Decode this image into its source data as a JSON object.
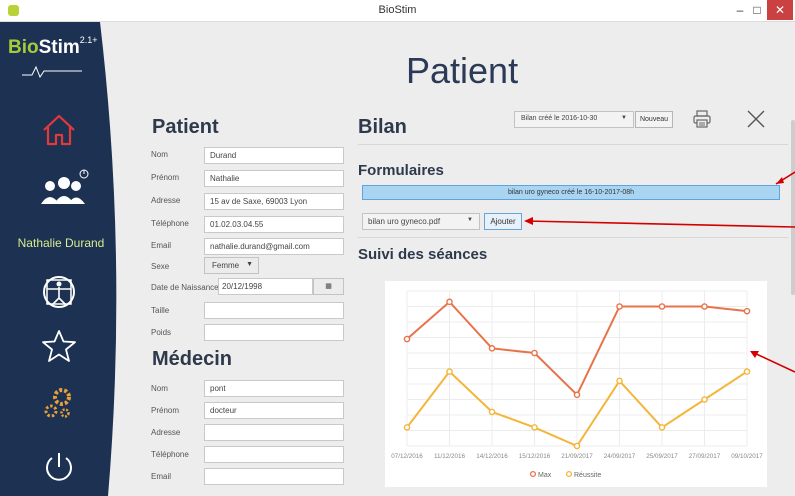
{
  "window": {
    "title": "BioStim",
    "minimize": "–",
    "maximize": "□",
    "close": "✕"
  },
  "sidebar": {
    "brand_bio": "Bio",
    "brand_stim": "Stim",
    "brand_version": "2.1+",
    "user_name": "Nathalie Durand",
    "items": [
      {
        "icon": "home-icon"
      },
      {
        "icon": "users-icon"
      },
      {
        "icon": "vitruvian-icon"
      },
      {
        "icon": "star-icon"
      },
      {
        "icon": "gears-icon"
      },
      {
        "icon": "power-icon"
      }
    ]
  },
  "page": {
    "title": "Patient"
  },
  "patient": {
    "heading": "Patient",
    "fields": [
      {
        "label": "Nom",
        "value": "Durand"
      },
      {
        "label": "Prénom",
        "value": "Nathalie"
      },
      {
        "label": "Adresse",
        "value": "15 av de Saxe, 69003 Lyon"
      },
      {
        "label": "Téléphone",
        "value": "01.02.03.04.55"
      },
      {
        "label": "Email",
        "value": "nathalie.durand@gmail.com"
      }
    ],
    "sexe_label": "Sexe",
    "sexe_value": "Femme",
    "dob_label": "Date de Naissance",
    "dob_value": "20/12/1998",
    "taille_label": "Taille",
    "taille_value": "",
    "poids_label": "Poids",
    "poids_value": ""
  },
  "medecin": {
    "heading": "Médecin",
    "fields": [
      {
        "label": "Nom",
        "value": "pont"
      },
      {
        "label": "Prénom",
        "value": "docteur"
      },
      {
        "label": "Adresse",
        "value": ""
      },
      {
        "label": "Téléphone",
        "value": ""
      },
      {
        "label": "Email",
        "value": ""
      }
    ]
  },
  "bilan": {
    "heading": "Bilan",
    "select_value": "Bilan créé le 2016-10-30",
    "nouveau_label": "Nouveau",
    "formulaires_heading": "Formulaires",
    "form_item": "bilan uro gyneco créé le 16-10-2017-08h",
    "pdf_select_value": "bilan uro gyneco.pdf",
    "ajouter_label": "Ajouter",
    "suivi_heading": "Suivi des séances"
  },
  "chart_data": {
    "type": "line",
    "x": [
      "07/12/2016",
      "11/12/2016",
      "14/12/2016",
      "15/12/2016",
      "21/09/2017",
      "24/09/2017",
      "25/09/2017",
      "27/09/2017",
      "09/10/2017"
    ],
    "series": [
      {
        "name": "Max",
        "values": [
          69,
          93,
          63,
          60,
          33,
          90,
          90,
          90,
          87
        ],
        "color": "#e8734a"
      },
      {
        "name": "Réussite",
        "values": [
          12,
          48,
          22,
          12,
          0,
          42,
          12,
          30,
          48
        ],
        "color": "#f5b53a"
      }
    ],
    "ylim": [
      0,
      100
    ],
    "grid": true,
    "legend": "bottom"
  },
  "colors": {
    "sidebar": "#1d3152",
    "accent_green": "#a4cc3a",
    "home_red": "#e03a3a"
  }
}
